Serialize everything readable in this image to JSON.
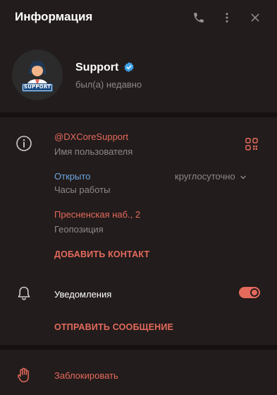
{
  "header": {
    "title": "Информация",
    "icons": [
      "phone-icon",
      "more-vertical-icon",
      "close-icon"
    ]
  },
  "profile": {
    "name": "Support",
    "status": "был(а) недавно",
    "avatar_text": "SUPPORT",
    "verified": true
  },
  "info": {
    "username": "@DXCoreSupport",
    "username_label": "Имя пользователя",
    "hours_status": "Открыто",
    "hours_value": "круглосуточно",
    "hours_label": "Часы работы",
    "address": "Пресненская наб., 2",
    "address_label": "Геопозиция",
    "add_contact": "ДОБАВИТЬ КОНТАКТ"
  },
  "notifications": {
    "label": "Уведомления",
    "enabled": true,
    "send_message": "ОТПРАВИТЬ СООБЩЕНИЕ"
  },
  "block": {
    "label": "Заблокировать"
  },
  "colors": {
    "background": "#231c1c",
    "accent_red": "#e46a5c",
    "accent_blue": "#6aa7e0",
    "verified_blue": "#3ea3e8",
    "muted": "#8f8888"
  }
}
